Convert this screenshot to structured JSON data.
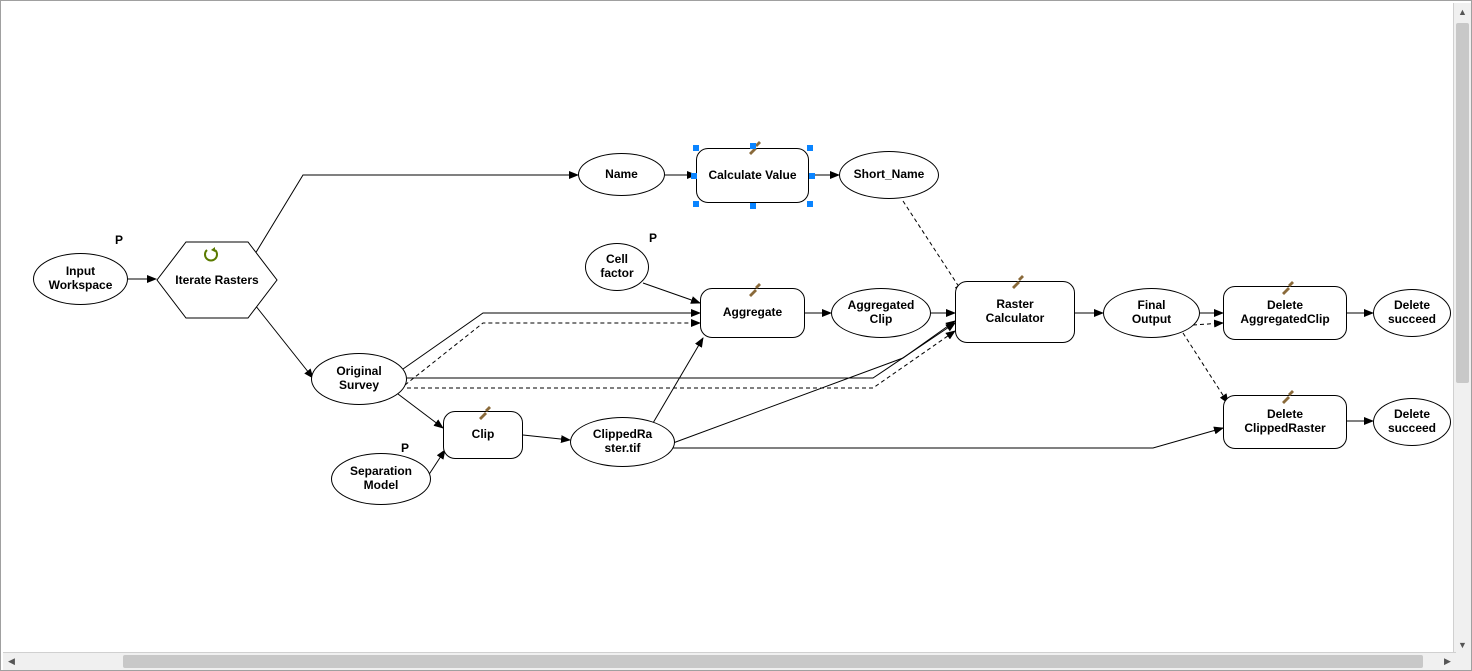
{
  "nodes": {
    "input_workspace": {
      "label": "Input\nWorkspace",
      "param": "P"
    },
    "iterate_rasters": {
      "label": "Iterate Rasters"
    },
    "name": {
      "label": "Name"
    },
    "calculate_value": {
      "label": "Calculate Value"
    },
    "short_name": {
      "label": "Short_Name"
    },
    "original_survey": {
      "label": "Original\nSurvey"
    },
    "cell_factor": {
      "label": "Cell\nfactor",
      "param": "P"
    },
    "aggregate": {
      "label": "Aggregate"
    },
    "aggregated_clip": {
      "label": "Aggregated\nClip"
    },
    "raster_calculator": {
      "label": "Raster\nCalculator"
    },
    "final_output": {
      "label": "Final\nOutput"
    },
    "delete_aggregatedclip": {
      "label": "Delete\nAggregatedClip"
    },
    "delete_succeed_1": {
      "label": "Delete\nsucceed"
    },
    "separation_model": {
      "label": "Separation\nModel",
      "param": "P"
    },
    "clip": {
      "label": "Clip"
    },
    "clipped_raster": {
      "label": "ClippedRa\nster.tif"
    },
    "delete_clippedraster": {
      "label": "Delete\nClippedRaster"
    },
    "delete_succeed_2": {
      "label": "Delete\nsucceed"
    }
  },
  "selected": "calculate_value",
  "icons": {
    "hammer": "tool-hammer",
    "loop": "iterator-loop"
  }
}
